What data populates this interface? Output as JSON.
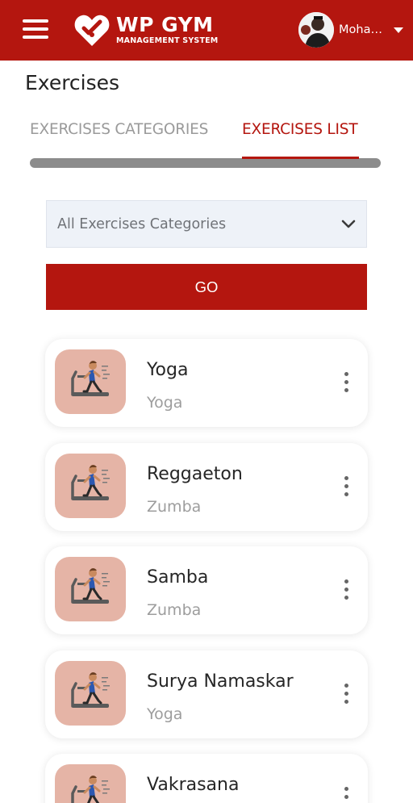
{
  "header": {
    "logo_title": "WP GYM",
    "logo_subtitle": "MANAGEMENT SYSTEM",
    "user_name": "Mohammed",
    "icons": [
      "hamburger-menu-icon",
      "wp-gym-logo-icon",
      "user-avatar",
      "caret-down-icon"
    ],
    "bar_color": "#b4160f"
  },
  "page": {
    "title": "Exercises"
  },
  "tabs": [
    {
      "label": "EXERCISES CATEGORIES",
      "active": false
    },
    {
      "label": "EXERCISES LIST",
      "active": true
    }
  ],
  "filter": {
    "selected": "All Exercises Categories",
    "go_label": "GO"
  },
  "exercises": [
    {
      "name": "Yoga",
      "category": "Yoga"
    },
    {
      "name": "Reggaeton",
      "category": "Zumba"
    },
    {
      "name": "Samba",
      "category": "Zumba"
    },
    {
      "name": "Surya Namaskar",
      "category": "Yoga"
    },
    {
      "name": "Vakrasana",
      "category": ""
    }
  ],
  "colors": {
    "accent": "#b4160f",
    "thumb_bg": "#e5b4a6",
    "muted": "#9d9d9d"
  }
}
